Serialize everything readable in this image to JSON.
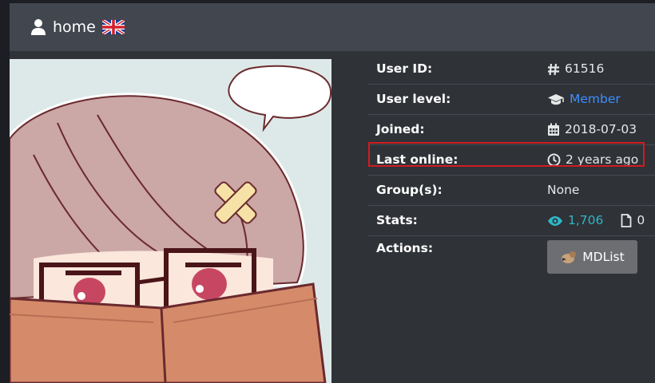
{
  "header": {
    "title": "home",
    "user_icon": "user-icon",
    "flag_icon": "uk-flag-icon"
  },
  "avatar": {
    "icon": "reading-anime-girl-avatar"
  },
  "info": {
    "user_id": {
      "label": "User ID:",
      "icon": "hash-icon",
      "value": "61516"
    },
    "user_level": {
      "label": "User level:",
      "icon": "graduation-cap-icon",
      "value": "Member"
    },
    "joined": {
      "label": "Joined:",
      "icon": "calendar-icon",
      "value": "2018-07-03"
    },
    "last_online": {
      "label": "Last online:",
      "icon": "clock-icon",
      "value": "2 years ago"
    },
    "groups": {
      "label": "Group(s):",
      "value": "None"
    },
    "stats": {
      "label": "Stats:",
      "views_icon": "eye-icon",
      "views": "1,706",
      "files_icon": "file-icon",
      "files": "0"
    },
    "actions": {
      "label": "Actions:",
      "button_label": "MDList",
      "button_icon": "mdlist-icon"
    }
  },
  "colors": {
    "link": "#3d8fff",
    "teal": "#2fb6c9",
    "highlight": "#d01c22",
    "header_bg": "#42474f"
  }
}
